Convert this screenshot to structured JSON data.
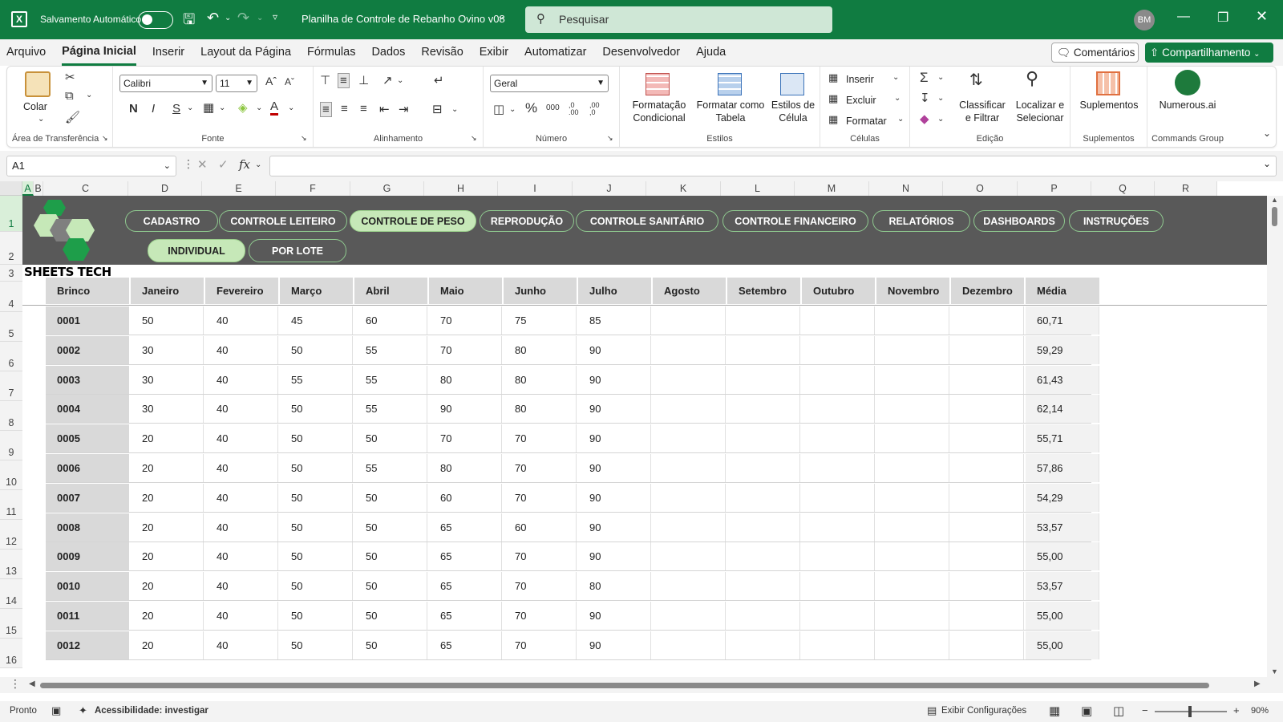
{
  "titlebar": {
    "autosave_label": "Salvamento Automático",
    "file_title": "Planilha de Controle de Rebanho Ovino v08",
    "search_placeholder": "Pesquisar",
    "user_initials": "BM"
  },
  "menu": {
    "items": [
      "Arquivo",
      "Página Inicial",
      "Inserir",
      "Layout da Página",
      "Fórmulas",
      "Dados",
      "Revisão",
      "Exibir",
      "Automatizar",
      "Desenvolvedor",
      "Ajuda"
    ],
    "active": "Página Inicial",
    "comments_label": "Comentários",
    "share_label": "Compartilhamento"
  },
  "ribbon": {
    "clipboard": {
      "paste_label": "Colar",
      "group_label": "Área de Transferência"
    },
    "font": {
      "font_name": "Calibri",
      "font_size": "11",
      "bold": "N",
      "italic": "I",
      "underline": "S",
      "group_label": "Fonte"
    },
    "alignment": {
      "group_label": "Alinhamento"
    },
    "number": {
      "format": "Geral",
      "percent": "%",
      "thousands": "000",
      "inc_dec": ",0 .00",
      "dec_dec": ",00 ,0",
      "group_label": "Número"
    },
    "styles": {
      "cond_format_line1": "Formatação",
      "cond_format_line2": "Condicional",
      "table_line1": "Formatar como",
      "table_line2": "Tabela",
      "cell_styles_line1": "Estilos de",
      "cell_styles_line2": "Célula",
      "group_label": "Estilos"
    },
    "cells": {
      "insert": "Inserir",
      "delete": "Excluir",
      "format": "Formatar",
      "group_label": "Células"
    },
    "editing": {
      "sort_line1": "Classificar",
      "sort_line2": "e Filtrar",
      "find_line1": "Localizar e",
      "find_line2": "Selecionar",
      "group_label": "Edição"
    },
    "addins": {
      "label": "Suplementos",
      "group_label": "Suplementos"
    },
    "commands": {
      "label": "Numerous.ai",
      "group_label": "Commands Group"
    }
  },
  "formulabar": {
    "name_box": "A1",
    "fx": "fx"
  },
  "columns": [
    "A",
    "B",
    "C",
    "D",
    "E",
    "F",
    "G",
    "H",
    "I",
    "J",
    "K",
    "L",
    "M",
    "N",
    "O",
    "P",
    "Q",
    "R"
  ],
  "rows": [
    "1",
    "2",
    "3",
    "4",
    "5",
    "6",
    "7",
    "8",
    "9",
    "10",
    "11",
    "12",
    "13",
    "14",
    "15",
    "16"
  ],
  "nav": {
    "top": [
      "CADASTRO",
      "CONTROLE LEITEIRO",
      "CONTROLE DE PESO",
      "REPRODUÇÃO",
      "CONTROLE SANITÁRIO",
      "CONTROLE FINANCEIRO",
      "RELATÓRIOS",
      "DASHBOARDS",
      "INSTRUÇÕES"
    ],
    "active_top": "CONTROLE DE PESO",
    "sub": [
      "INDIVIDUAL",
      "POR LOTE"
    ],
    "active_sub": "INDIVIDUAL"
  },
  "brand": "SHEETS TECH",
  "table": {
    "headers": [
      "Brinco",
      "Janeiro",
      "Fevereiro",
      "Março",
      "Abril",
      "Maio",
      "Junho",
      "Julho",
      "Agosto",
      "Setembro",
      "Outubro",
      "Novembro",
      "Dezembro",
      "Média"
    ],
    "rows": [
      [
        "0001",
        "50",
        "40",
        "45",
        "60",
        "70",
        "75",
        "85",
        "",
        "",
        "",
        "",
        "",
        "60,71"
      ],
      [
        "0002",
        "30",
        "40",
        "50",
        "55",
        "70",
        "80",
        "90",
        "",
        "",
        "",
        "",
        "",
        "59,29"
      ],
      [
        "0003",
        "30",
        "40",
        "55",
        "55",
        "80",
        "80",
        "90",
        "",
        "",
        "",
        "",
        "",
        "61,43"
      ],
      [
        "0004",
        "30",
        "40",
        "50",
        "55",
        "90",
        "80",
        "90",
        "",
        "",
        "",
        "",
        "",
        "62,14"
      ],
      [
        "0005",
        "20",
        "40",
        "50",
        "50",
        "70",
        "70",
        "90",
        "",
        "",
        "",
        "",
        "",
        "55,71"
      ],
      [
        "0006",
        "20",
        "40",
        "50",
        "55",
        "80",
        "70",
        "90",
        "",
        "",
        "",
        "",
        "",
        "57,86"
      ],
      [
        "0007",
        "20",
        "40",
        "50",
        "50",
        "60",
        "70",
        "90",
        "",
        "",
        "",
        "",
        "",
        "54,29"
      ],
      [
        "0008",
        "20",
        "40",
        "50",
        "50",
        "65",
        "60",
        "90",
        "",
        "",
        "",
        "",
        "",
        "53,57"
      ],
      [
        "0009",
        "20",
        "40",
        "50",
        "50",
        "65",
        "70",
        "90",
        "",
        "",
        "",
        "",
        "",
        "55,00"
      ],
      [
        "0010",
        "20",
        "40",
        "50",
        "50",
        "65",
        "70",
        "80",
        "",
        "",
        "",
        "",
        "",
        "53,57"
      ],
      [
        "0011",
        "20",
        "40",
        "50",
        "50",
        "65",
        "70",
        "90",
        "",
        "",
        "",
        "",
        "",
        "55,00"
      ],
      [
        "0012",
        "20",
        "40",
        "50",
        "50",
        "65",
        "70",
        "90",
        "",
        "",
        "",
        "",
        "",
        "55,00"
      ]
    ]
  },
  "statusbar": {
    "ready": "Pronto",
    "accessibility": "Acessibilidade: investigar",
    "display_settings": "Exibir Configurações",
    "zoom": "90%"
  },
  "colors": {
    "excel_green": "#107c41",
    "banner": "#595959",
    "pill_active": "#c6e8b8",
    "header_cell": "#d9d9d9"
  }
}
